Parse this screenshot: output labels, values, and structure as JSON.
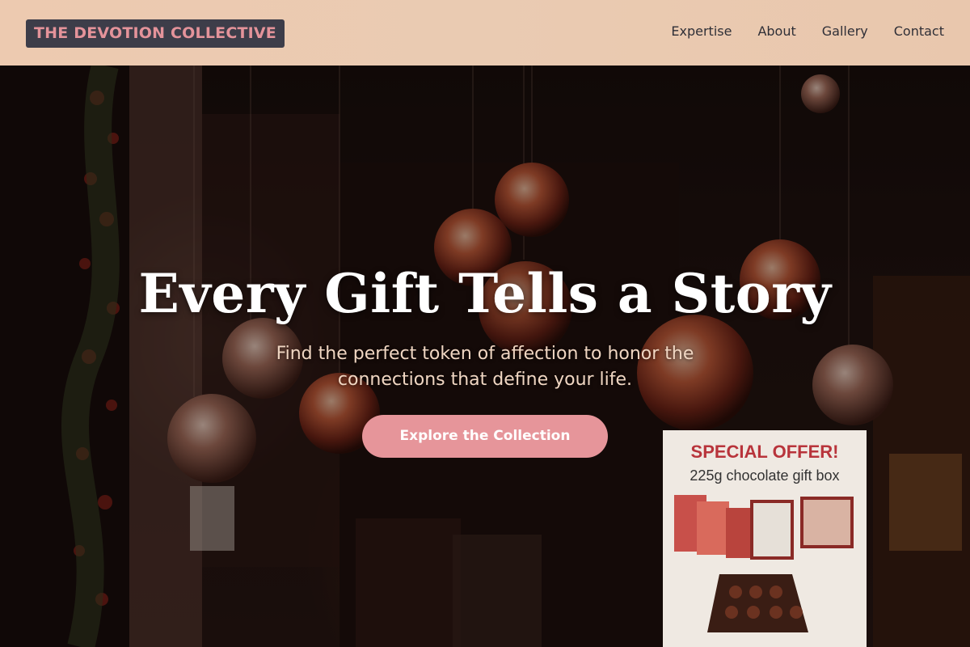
{
  "header": {
    "logo": "THE DEVOTION COLLECTIVE",
    "nav": [
      "Expertise",
      "About",
      "Gallery",
      "Contact"
    ]
  },
  "hero": {
    "title": "Every Gift Tells a Story",
    "subtitle": "Find the perfect token of affection to honor the connections that define your life.",
    "cta": "Explore the Collection",
    "sign": {
      "title": "SPECIAL OFFER!",
      "subtitle": "225g chocolate gift box"
    }
  },
  "colors": {
    "header_bg": "#eacbb2",
    "logo_bg": "#3d3d49",
    "logo_text": "#e4939a",
    "cta_bg": "#e6959a",
    "nav_text": "#2f2f37"
  }
}
